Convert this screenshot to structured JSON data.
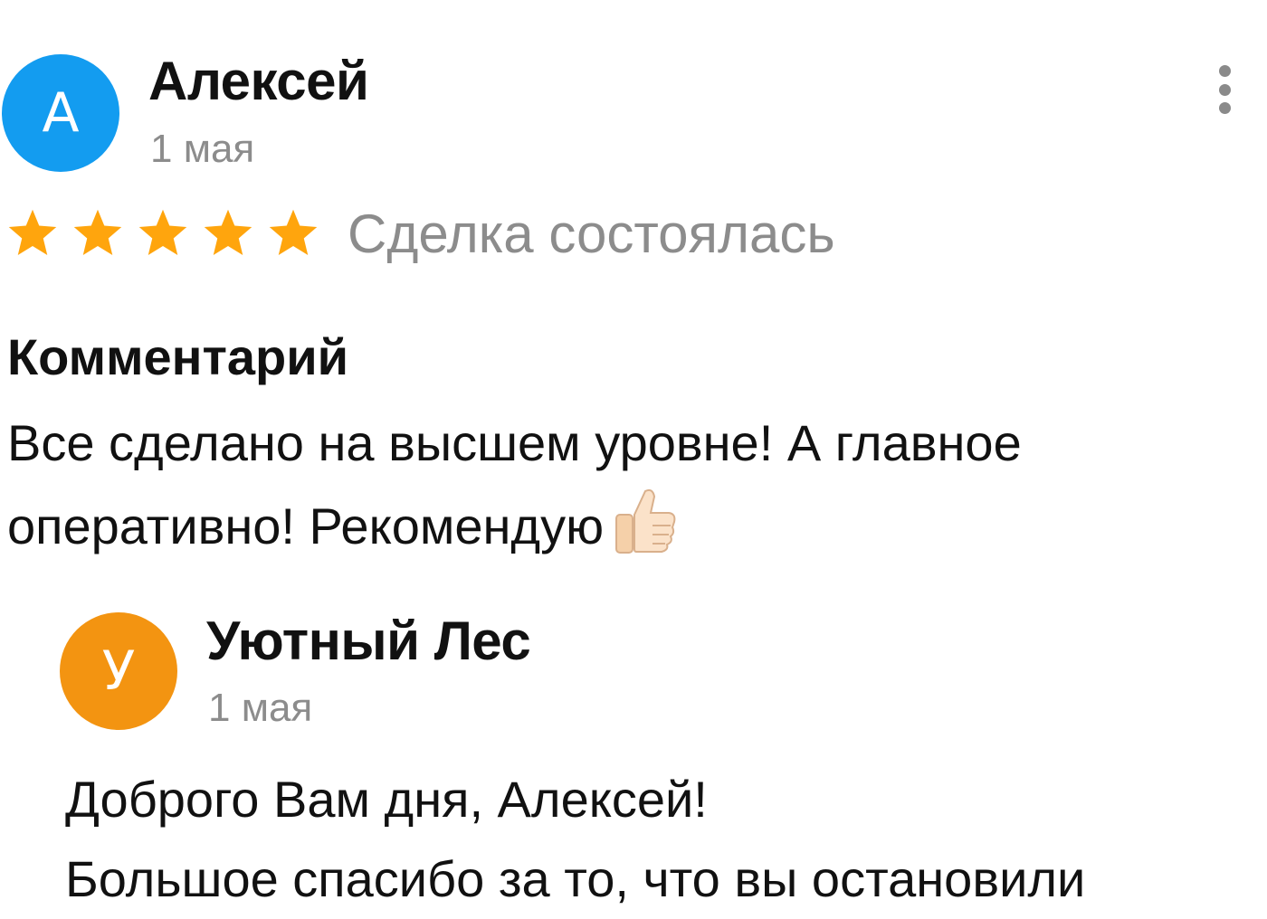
{
  "review": {
    "avatar_letter": "А",
    "avatar_color": "#139cf0",
    "author_name": "Алексей",
    "date": "1 мая",
    "rating": 5,
    "rating_max": 5,
    "star_color": "#ffa50d",
    "deal_status": "Сделка состоялась",
    "comment_heading": "Комментарий",
    "comment_text": "Все сделано на высшем уровне! А главное оперативно! Рекомендую",
    "comment_emoji": "thumbs-up-icon"
  },
  "menu": {
    "icon": "more-vertical-icon"
  },
  "reply": {
    "avatar_letter": "У",
    "avatar_color": "#f39411",
    "author_name": "Уютный Лес",
    "date": "1 мая",
    "lines": [
      "Доброго Вам дня, Алексей!",
      "Большое спасибо за то, что вы остановили"
    ]
  }
}
